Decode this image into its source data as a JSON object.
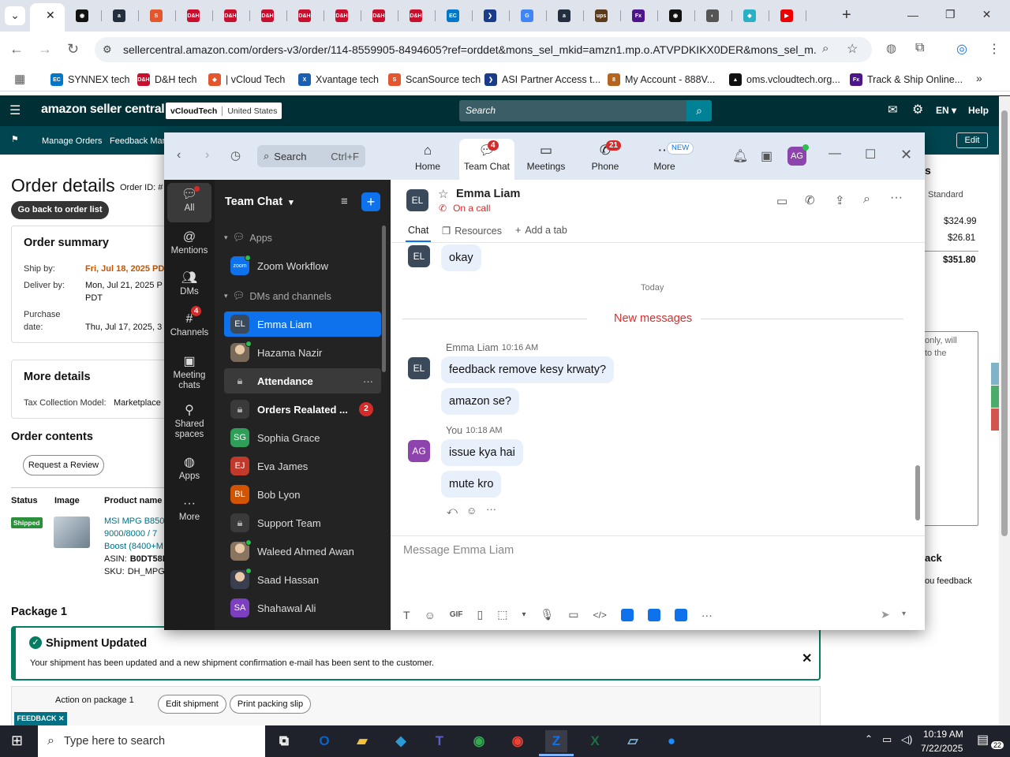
{
  "browser": {
    "tabs": [
      {
        "icon": "chevron-down-icon",
        "color": "#5f6368",
        "glyph": "⌄"
      },
      {
        "icon": "active-tab-icon",
        "color": "#fff",
        "glyph": "."
      },
      {
        "icon": "openai-icon",
        "color": "#111",
        "glyph": "◉"
      },
      {
        "icon": "amazon-icon",
        "color": "#232f3e",
        "glyph": "a"
      },
      {
        "icon": "scansource-icon",
        "color": "#e4572e",
        "glyph": "S"
      },
      {
        "icon": "dh-icon",
        "color": "#c8102e",
        "glyph": "D&H"
      },
      {
        "icon": "dh-icon",
        "color": "#c8102e",
        "glyph": "D&H"
      },
      {
        "icon": "dh-icon",
        "color": "#c8102e",
        "glyph": "D&H"
      },
      {
        "icon": "dh-icon",
        "color": "#c8102e",
        "glyph": "D&H"
      },
      {
        "icon": "dh-icon",
        "color": "#c8102e",
        "glyph": "D&H"
      },
      {
        "icon": "dh-icon",
        "color": "#c8102e",
        "glyph": "D&H"
      },
      {
        "icon": "dh-icon",
        "color": "#c8102e",
        "glyph": "D&H"
      },
      {
        "icon": "ec-icon",
        "color": "#0077c8",
        "glyph": "EC"
      },
      {
        "icon": "asi-icon",
        "color": "#1a3a8a",
        "glyph": "❯"
      },
      {
        "icon": "google-icon",
        "color": "#4285f4",
        "glyph": "G"
      },
      {
        "icon": "amazon-icon",
        "color": "#232f3e",
        "glyph": "a"
      },
      {
        "icon": "ups-icon",
        "color": "#5b3a1e",
        "glyph": "ups"
      },
      {
        "icon": "fedex-icon",
        "color": "#4d148c",
        "glyph": "Fx"
      },
      {
        "icon": "openai-icon",
        "color": "#111",
        "glyph": "◉"
      },
      {
        "icon": "incognito-icon",
        "color": "#555",
        "glyph": "◐"
      },
      {
        "icon": "vcloud-icon",
        "color": "#2ab0c5",
        "glyph": "◆"
      },
      {
        "icon": "youtube-icon",
        "color": "#e00",
        "glyph": "▶"
      }
    ],
    "url": "sellercentral.amazon.com/orders-v3/order/114-8559905-8494605?ref=orddet&mons_sel_mkid=amzn1.mp.o.ATVPDKIKX0DER&mons_sel_m...",
    "bookmarks": [
      {
        "label": "SYNNEX tech",
        "icon": "ec-icon",
        "color": "#0077c8",
        "glyph": "EC"
      },
      {
        "label": "D&H tech",
        "icon": "dh-icon",
        "color": "#c8102e",
        "glyph": "D&H"
      },
      {
        "label": "| vCloud Tech",
        "icon": "vcloud-icon",
        "color": "#e4572e",
        "glyph": "◆"
      },
      {
        "label": "Xvantage tech",
        "icon": "xvantage-icon",
        "color": "#1a5fb4",
        "glyph": "X"
      },
      {
        "label": "ScanSource tech",
        "icon": "scansource-icon",
        "color": "#e4572e",
        "glyph": "S"
      },
      {
        "label": "ASI Partner Access t...",
        "icon": "asi-icon",
        "color": "#1a3a8a",
        "glyph": "❯"
      },
      {
        "label": "My Account - 888V...",
        "icon": "account-icon",
        "color": "#b5651d",
        "glyph": "8"
      },
      {
        "label": "oms.vcloudtech.org...",
        "icon": "oms-icon",
        "color": "#111",
        "glyph": "▲"
      },
      {
        "label": "Track & Ship Online...",
        "icon": "fedex-icon",
        "color": "#4d148c",
        "glyph": "Fx"
      }
    ]
  },
  "amazon": {
    "logo": "amazon seller central",
    "store_name": "vCloudTech",
    "store_region": "United States",
    "search_placeholder": "Search",
    "lang": "EN",
    "help": "Help",
    "sub_links": [
      "Manage Orders",
      "Feedback Man"
    ],
    "edit": "Edit",
    "title": "Order details",
    "order_id_label": "Order ID: #",
    "back_button": "Go back to order list",
    "summary": {
      "heading": "Order summary",
      "ship_by_label": "Ship by:",
      "ship_by_value": "Fri, Jul 18, 2025 PD",
      "deliver_by_label": "Deliver by:",
      "deliver_by_value": "Mon, Jul 21, 2025 P",
      "deliver_by_tz": "PDT",
      "purchase_label_1": "Purchase",
      "purchase_label_2": "date:",
      "purchase_value": "Thu, Jul 17, 2025, 3"
    },
    "more_details": {
      "heading": "More details",
      "tax_label": "Tax Collection Model:",
      "tax_value": "Marketplace"
    },
    "contents": {
      "heading": "Order contents",
      "review_button": "Request a Review",
      "columns": [
        "Status",
        "Image",
        "Product name"
      ],
      "status": "Shipped",
      "product_lines": [
        "MSI MPG B850",
        "9000/8000 / 7",
        "Boost (8400+M"
      ],
      "asin_label": "ASIN:",
      "asin": "B0DT58F",
      "sku_label": "SKU:",
      "sku": "DH_MPGE"
    },
    "right": {
      "s_heading": "s",
      "standard": "Standard",
      "price1": "$324.99",
      "price2": "$26.81",
      "total": "$351.80",
      "note1": "only, will",
      "note2": "to the",
      "back_heading": "ack",
      "back_text": "ou feedback",
      "side_w": "W",
      "side_a": "Ac",
      "side_i": "In"
    },
    "package": {
      "heading": "Package 1",
      "banner_title": "Shipment Updated",
      "banner_text": "Your shipment has been updated and a new shipment confirmation e-mail has been sent to the customer.",
      "action_label": "Action on package 1",
      "edit_shipment": "Edit shipment",
      "print_slip": "Print packing slip"
    },
    "feedback_tab": "FEEDBACK ✕"
  },
  "zoom": {
    "search_label": "Search",
    "search_shortcut": "Ctrl+F",
    "nav": [
      {
        "label": "Home",
        "badge": ""
      },
      {
        "label": "Team Chat",
        "badge": "4"
      },
      {
        "label": "Meetings",
        "badge": ""
      },
      {
        "label": "Phone",
        "badge": "21"
      },
      {
        "label": "More",
        "badge": "NEW"
      }
    ],
    "self_avatar": "AG",
    "rail": [
      {
        "label": "All",
        "badge": ""
      },
      {
        "label": "Mentions",
        "badge": ""
      },
      {
        "label": "DMs",
        "badge": ""
      },
      {
        "label": "Channels",
        "badge": "4"
      },
      {
        "label": "Meeting chats",
        "badge": ""
      },
      {
        "label": "Shared spaces",
        "badge": ""
      },
      {
        "label": "Apps",
        "badge": ""
      },
      {
        "label": "More",
        "badge": ""
      }
    ],
    "list_title": "Team Chat",
    "section_apps": "Apps",
    "zoom_workflow": "Zoom Workflow",
    "section_dms": "DMs and channels",
    "contacts": [
      {
        "name": "Emma Liam",
        "initials": "EL",
        "color": "#3b4a5a",
        "bold": false,
        "badge": ""
      },
      {
        "name": "Hazama Nazir",
        "initials": "",
        "color": "#7a6a5a",
        "bold": false,
        "badge": ""
      },
      {
        "name": "Attendance",
        "initials": "",
        "color": "",
        "bold": true,
        "badge": ""
      },
      {
        "name": "Orders Realated ...",
        "initials": "",
        "color": "",
        "bold": true,
        "badge": "2"
      },
      {
        "name": "Sophia Grace",
        "initials": "SG",
        "color": "#2e9e58",
        "bold": false,
        "badge": ""
      },
      {
        "name": "Eva James",
        "initials": "EJ",
        "color": "#c0392b",
        "bold": false,
        "badge": ""
      },
      {
        "name": "Bob Lyon",
        "initials": "BL",
        "color": "#d35400",
        "bold": false,
        "badge": ""
      },
      {
        "name": "Support Team",
        "initials": "",
        "color": "",
        "bold": false,
        "badge": ""
      },
      {
        "name": "Waleed Ahmed Awan",
        "initials": "",
        "color": "#8a7560",
        "bold": false,
        "badge": ""
      },
      {
        "name": "Saad Hassan",
        "initials": "",
        "color": "#3a3f50",
        "bold": false,
        "badge": ""
      },
      {
        "name": "Shahawal Ali",
        "initials": "SA",
        "color": "#7b3fbf",
        "bold": false,
        "badge": ""
      }
    ],
    "chat": {
      "contact_name": "Emma Liam",
      "contact_initials": "EL",
      "status": "On a call",
      "tabs": [
        "Chat",
        "Resources",
        "Add a tab"
      ],
      "old_message": "okay",
      "day_divider": "Today",
      "new_divider": "New messages",
      "msg1_sender": "Emma Liam",
      "msg1_time": "10:16 AM",
      "msg1_a": "feedback remove kesy krwaty?",
      "msg1_b": "amazon se?",
      "msg2_sender": "You",
      "msg2_time": "10:18 AM",
      "msg2_initials": "AG",
      "msg2_a": "issue kya hai",
      "msg2_b": "mute kro",
      "compose_placeholder": "Message Emma Liam",
      "gif": "GIF"
    }
  },
  "taskbar": {
    "search_placeholder": "Type here to search",
    "time": "10:19 AM",
    "date": "7/22/2025",
    "zoom_badge": "25",
    "notif_count": "22"
  }
}
